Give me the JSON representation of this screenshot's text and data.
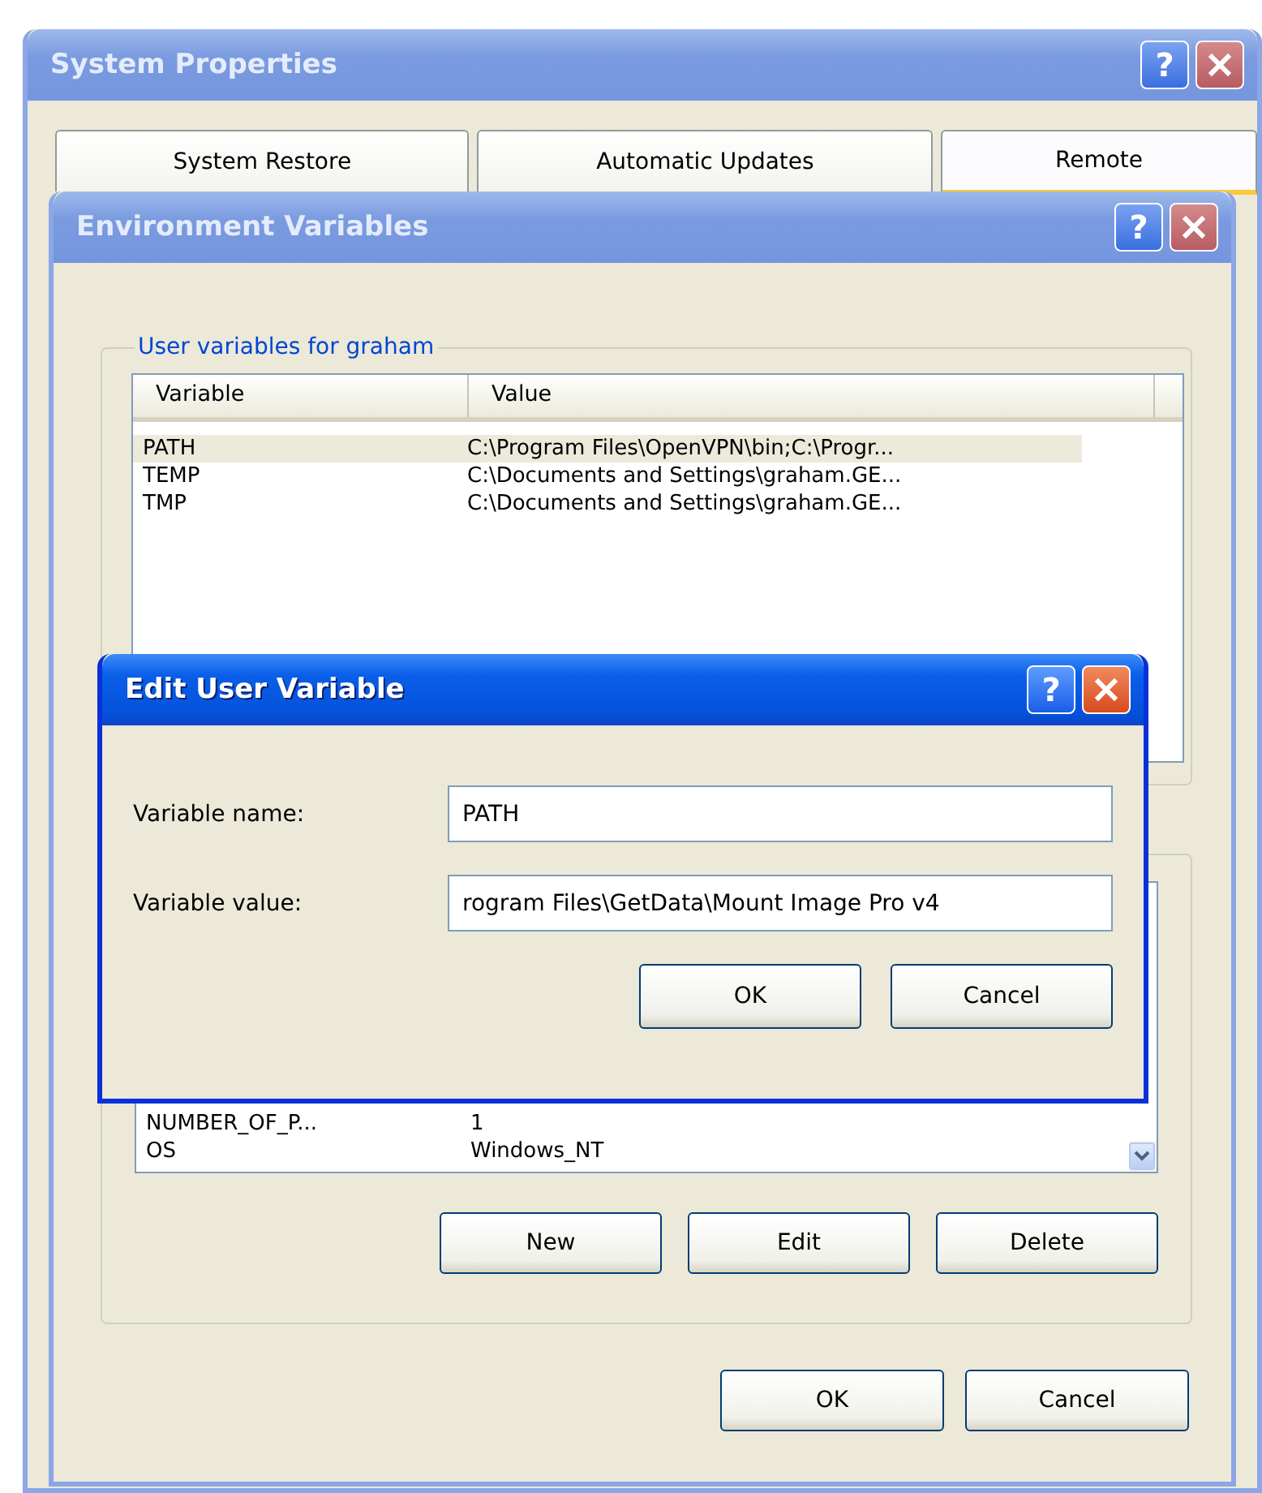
{
  "system_properties": {
    "title": "System Properties",
    "active": false,
    "help": "?",
    "tabs": [
      {
        "label": "System Restore",
        "selected": false
      },
      {
        "label": "Automatic Updates",
        "selected": false
      },
      {
        "label": "Remote",
        "selected": true
      }
    ]
  },
  "environment_variables": {
    "title": "Environment Variables",
    "active": false,
    "help": "?",
    "user_variables": {
      "title": "User variables for graham",
      "columns": [
        "Variable",
        "Value"
      ],
      "rows": [
        {
          "variable": "PATH",
          "value": "C:\\Program Files\\OpenVPN\\bin;C:\\Progr...",
          "selected": true
        },
        {
          "variable": "TEMP",
          "value": "C:\\Documents and Settings\\graham.GE...",
          "selected": false
        },
        {
          "variable": "TMP",
          "value": "C:\\Documents and Settings\\graham.GE...",
          "selected": false
        }
      ]
    },
    "system_variables": {
      "rows": [
        {
          "variable": "NUMBER_OF_P...",
          "value": "1",
          "selected": false
        },
        {
          "variable": "OS",
          "value": "Windows_NT",
          "selected": false
        }
      ],
      "buttons": [
        "New",
        "Edit",
        "Delete"
      ]
    },
    "buttons": [
      "OK",
      "Cancel"
    ]
  },
  "edit_user_variable": {
    "title": "Edit User Variable",
    "active": true,
    "help": "?",
    "fields": [
      {
        "label": "Variable name:",
        "value": "PATH"
      },
      {
        "label": "Variable value:",
        "value": "rogram Files\\GetData\\Mount Image Pro v4"
      }
    ],
    "buttons": [
      "OK",
      "Cancel"
    ]
  }
}
